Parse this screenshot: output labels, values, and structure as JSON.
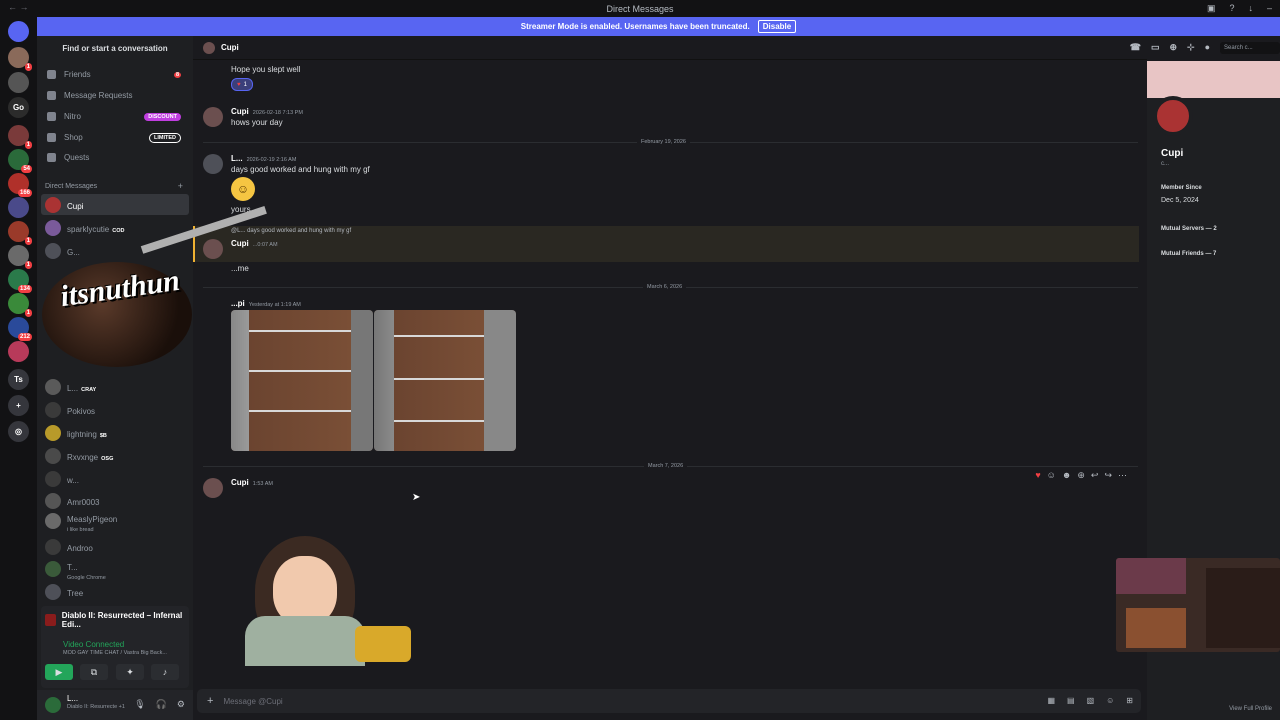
{
  "titlebar": {
    "title": "Direct Messages",
    "back": "← →"
  },
  "banner": {
    "text": "Streamer Mode is enabled. Usernames have been truncated.",
    "button": "Disable"
  },
  "guilds": [
    {
      "label": "",
      "badge": ""
    },
    {
      "label": "",
      "badge": "1"
    },
    {
      "label": "",
      "badge": ""
    },
    {
      "label": "Go",
      "badge": ""
    },
    {
      "label": "",
      "badge": "1"
    },
    {
      "label": "",
      "badge": "54"
    },
    {
      "label": "",
      "badge": "166"
    },
    {
      "label": "",
      "badge": ""
    },
    {
      "label": "",
      "badge": "1"
    },
    {
      "label": "",
      "badge": "1"
    },
    {
      "label": "",
      "badge": "134"
    },
    {
      "label": "",
      "badge": "1"
    },
    {
      "label": "",
      "badge": "212"
    },
    {
      "label": "",
      "badge": ""
    },
    {
      "label": "Ts",
      "badge": ""
    },
    {
      "label": "+",
      "badge": ""
    },
    {
      "label": "◎",
      "badge": ""
    }
  ],
  "sidebar": {
    "search": "Find or start a conversation",
    "nav": [
      {
        "label": "Friends",
        "tag": "",
        "badge": "8"
      },
      {
        "label": "Message Requests",
        "tag": ""
      },
      {
        "label": "Nitro",
        "tag": "DISCOUNT"
      },
      {
        "label": "Shop",
        "tag": "LIMITED"
      },
      {
        "label": "Quests",
        "tag": ""
      }
    ],
    "dm_header": "Direct Messages",
    "dms": [
      {
        "name": "Cupi",
        "sub": "",
        "tag": ""
      },
      {
        "name": "sparklycutie",
        "sub": "",
        "tag": "COD"
      },
      {
        "name": "G...",
        "sub": "",
        "tag": ""
      },
      {
        "name": "L...",
        "sub": "",
        "tag": "CRAY"
      },
      {
        "name": "Pokivos",
        "sub": "",
        "tag": ""
      },
      {
        "name": "lightning",
        "sub": "",
        "tag": "$B"
      },
      {
        "name": "Rxvxnge",
        "sub": "",
        "tag": "OSG"
      },
      {
        "name": "w...",
        "sub": "",
        "tag": ""
      },
      {
        "name": "Amr0003",
        "sub": "",
        "tag": ""
      },
      {
        "name": "MeaslyPigeon",
        "sub": "i like bread",
        "tag": ""
      },
      {
        "name": "Androo",
        "sub": "",
        "tag": ""
      },
      {
        "name": "T...",
        "sub": "Google Chrome",
        "tag": ""
      },
      {
        "name": "Tree",
        "sub": "",
        "tag": ""
      }
    ],
    "game": "Diablo II: Resurrected – Infernal Edi...",
    "voice_status": "Video Connected",
    "voice_sub": "MOD GAY TIME CHAT / Vastra Big Back...",
    "user": {
      "name": "L...",
      "status": "Diablo II: Resurrecte +1"
    }
  },
  "chat": {
    "header_name": "Cupi",
    "search_placeholder": "Search c...",
    "messages": [
      {
        "text": "Hope you slept well",
        "reaction_count": "1"
      },
      {
        "author": "Cupi",
        "time": "2026-02-18 7:13 PM",
        "text": "hows your day"
      },
      {
        "divider": "February 19, 2026"
      },
      {
        "author": "L...",
        "time": "2026-02-19 2:16 AM",
        "text": "days good worked and hung with my gf",
        "extra": "yours"
      },
      {
        "reply": "@L... days good worked and hung with my gf",
        "author": "Cupi",
        "time": "...0:07 AM",
        "text": "...me"
      },
      {
        "divider": "March 6, 2026"
      },
      {
        "author": "...pi",
        "time": "Yesterday at 1:19 AM"
      },
      {
        "divider": "March 7, 2026"
      },
      {
        "author": "Cupi",
        "time": "1:53 AM"
      }
    ],
    "input_placeholder": "Message @Cupi"
  },
  "profile": {
    "name": "Cupi",
    "sub": "c...",
    "member_label": "Member Since",
    "member_date": "Dec 5, 2024",
    "mutual_servers": "Mutual Servers — 2",
    "mutual_friends": "Mutual Friends — 7",
    "full_profile": "View Full Profile"
  },
  "overlay": {
    "logo_text": "itsnuthun"
  },
  "colors": {
    "accent": "#5865f2",
    "online": "#23a55a",
    "badge": "#f23f43",
    "discount": "#c03ee0"
  }
}
